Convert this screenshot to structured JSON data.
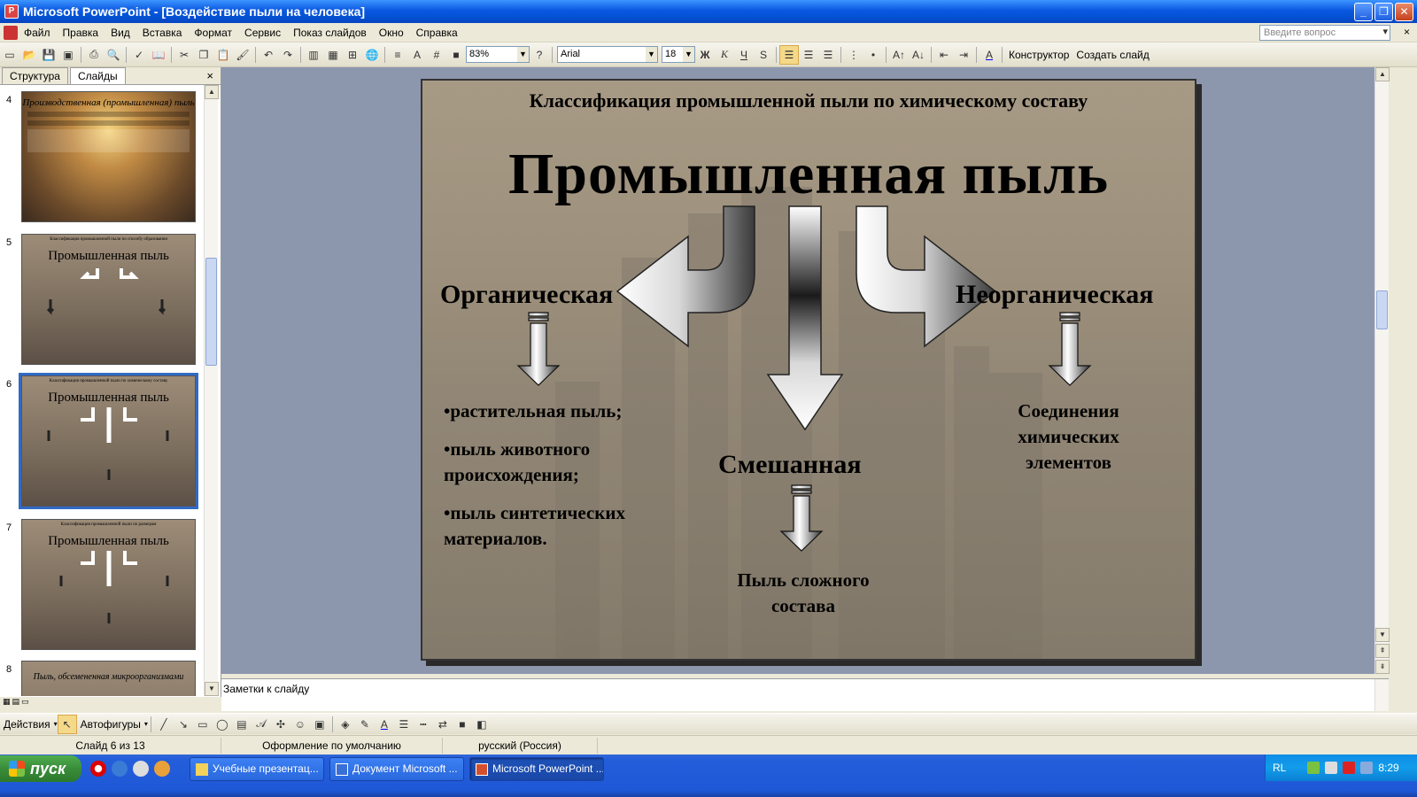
{
  "window": {
    "title": "Microsoft PowerPoint - [Воздействие пыли  на человека]",
    "minimize": "_",
    "restore": "❐",
    "close": "✕"
  },
  "menu": {
    "items": [
      "Файл",
      "Правка",
      "Вид",
      "Вставка",
      "Формат",
      "Сервис",
      "Показ слайдов",
      "Окно",
      "Справка"
    ],
    "help_placeholder": "Введите вопрос",
    "close": "×"
  },
  "toolbar": {
    "zoom": "83%",
    "font": "Arial",
    "font_size": "18",
    "bold": "Ж",
    "italic": "К",
    "underline": "Ч",
    "shadow": "S",
    "designer": "Конструктор",
    "new_slide": "Создать слайд"
  },
  "left_pane": {
    "tab_outline": "Структура",
    "tab_slides": "Слайды",
    "close": "×",
    "thumbnails": [
      {
        "num": "4",
        "title": "Производственная (промышленная) пыль"
      },
      {
        "num": "5",
        "title": "Промышленная пыль",
        "caption": "Классификация промышленной пыли по способу образования"
      },
      {
        "num": "6",
        "title": "Промышленная пыль",
        "caption": "Классификация промышленной пыли по химическому составу"
      },
      {
        "num": "7",
        "title": "Промышленная пыль",
        "caption": "Классификация промышленной пыли по размерам"
      },
      {
        "num": "8",
        "title": "Пыль, обсемененная микроорганизмами"
      }
    ]
  },
  "slide": {
    "title": "Классификация промышленной пыли по химическому составу",
    "main": "Промышленная пыль",
    "organic": "Органическая",
    "inorganic": "Неорганическая",
    "mixed": "Смешанная",
    "organic_items": [
      "•растительная пыль;",
      "•пыль животного происхождения;",
      "•пыль синтетических материалов."
    ],
    "inorganic_desc": "Соединения химических элементов",
    "mixed_desc": "Пыль сложного состава"
  },
  "notes": {
    "placeholder": "Заметки к слайду"
  },
  "drawbar": {
    "actions": "Действия",
    "autoshapes": "Автофигуры"
  },
  "status": {
    "slide_counter": "Слайд 6 из 13",
    "design": "Оформление по умолчанию",
    "language": "русский (Россия)"
  },
  "taskbar": {
    "start": "пуск",
    "tasks": [
      "Учебные презентац...",
      "Документ Microsoft ...",
      "Microsoft PowerPoint ..."
    ],
    "lang": "RL",
    "clock": "8:29"
  }
}
